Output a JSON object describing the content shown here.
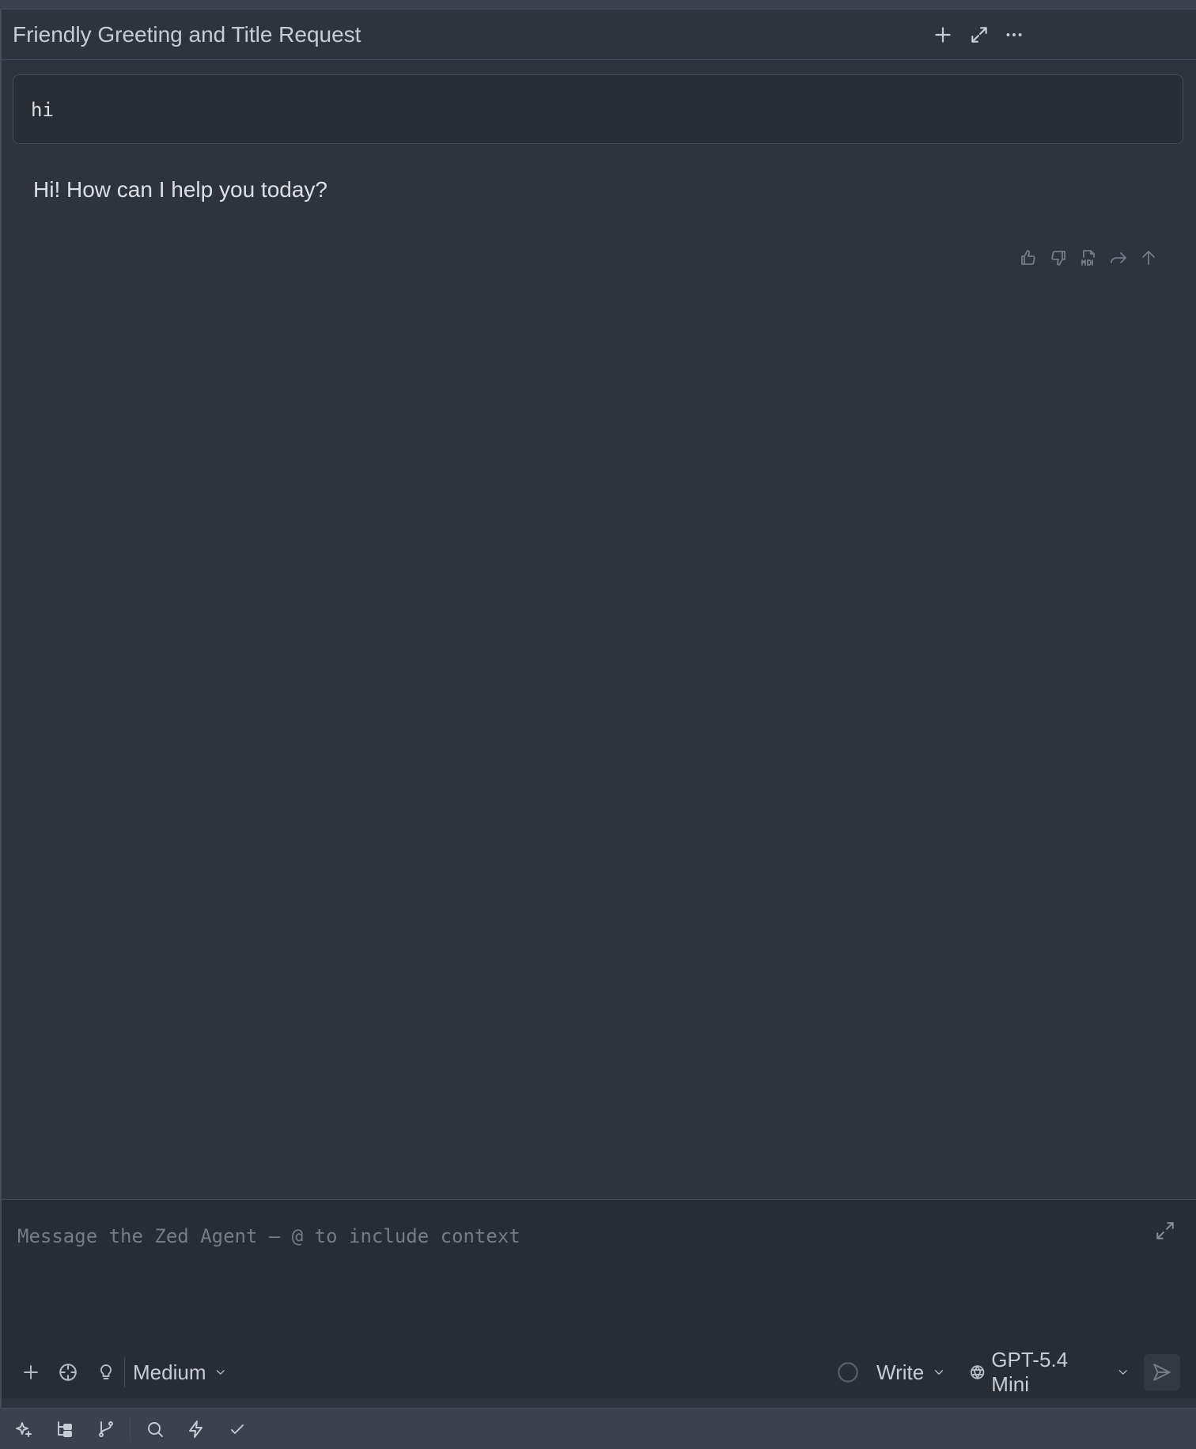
{
  "header": {
    "title": "Friendly Greeting and Title Request",
    "icons": [
      "plus-icon",
      "maximize-icon",
      "ellipsis-icon"
    ]
  },
  "thread": {
    "user_message": "hi",
    "assistant_message": "Hi! How can I help you today?",
    "message_actions": [
      "thumbs-up-icon",
      "thumbs-down-icon",
      "markdown-file-icon",
      "forward-icon",
      "arrow-up-icon"
    ]
  },
  "composer": {
    "placeholder": "Message the Zed Agent — @ to include context",
    "value": "",
    "thinking_level": "Medium",
    "mode": "Write",
    "model": "GPT-5.4 Mini"
  },
  "statusbar": {
    "icons": [
      "ai-sparkle-icon",
      "project-panel-icon",
      "git-branch-icon",
      "search-icon",
      "bolt-icon",
      "check-icon"
    ]
  },
  "colors": {
    "background": "#2f333d",
    "composer_bg": "#282c34",
    "border": "#464b57",
    "text": "#dce0e5",
    "muted": "#767b86"
  }
}
